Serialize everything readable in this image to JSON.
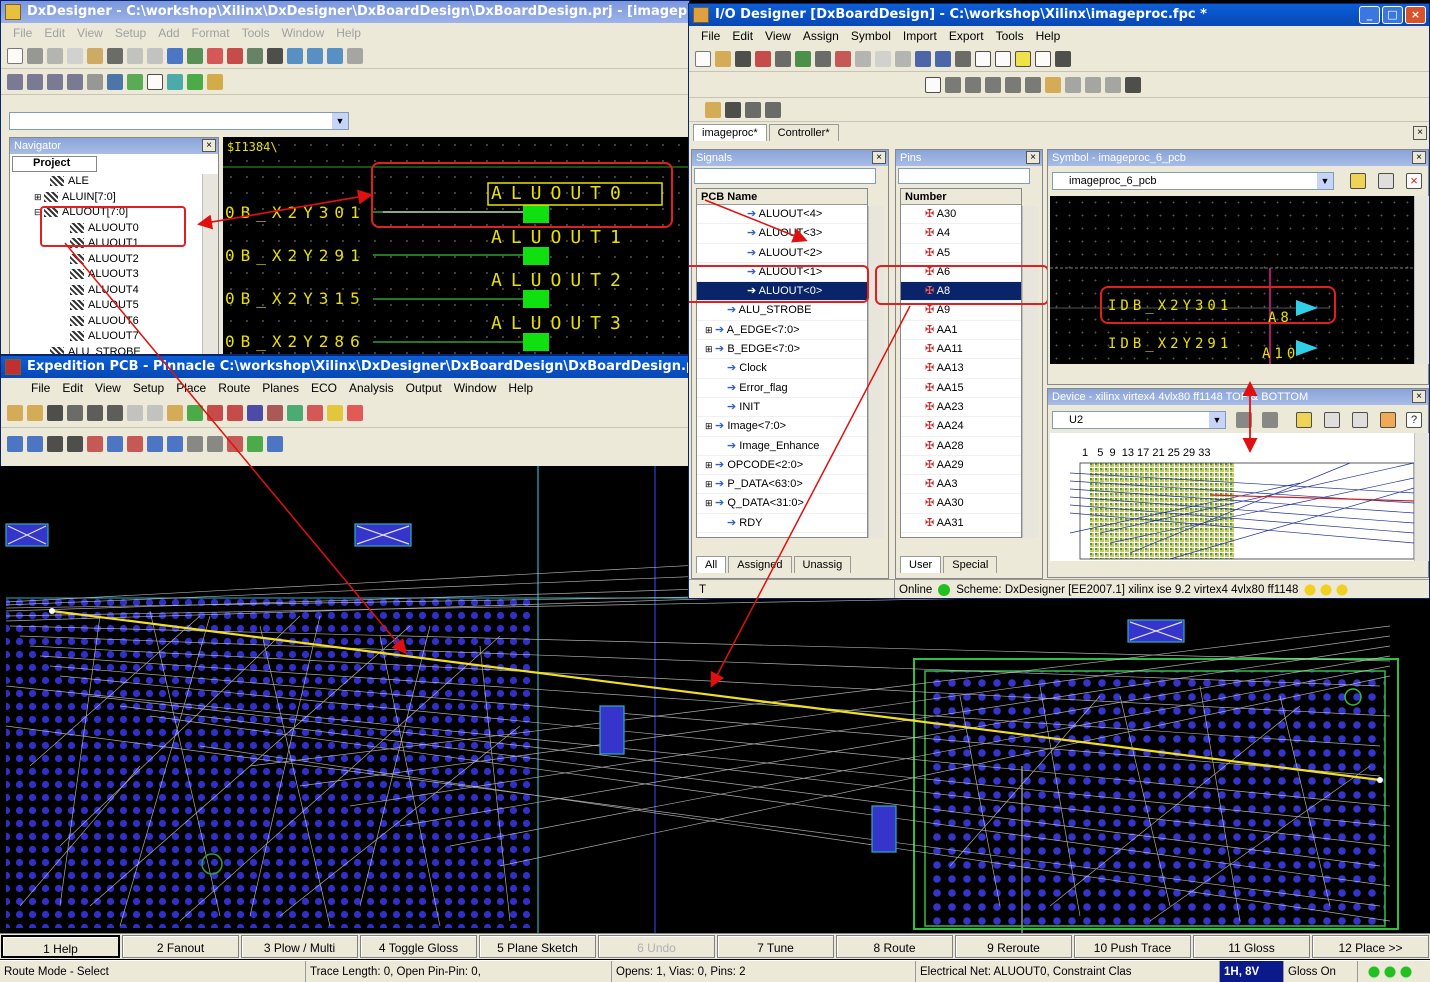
{
  "dx": {
    "title": "DxDesigner - C:\\workshop\\Xilinx\\DxDesigner\\DxBoardDesign\\DxBoardDesign.prj - [imageproc.1]",
    "menu": [
      "File",
      "Edit",
      "View",
      "Setup",
      "Add",
      "Format",
      "Tools",
      "Window",
      "Help"
    ],
    "navigator": "Navigator",
    "project_tab": "Project",
    "tree": [
      "ALE",
      "ALUIN[7:0]",
      "ALUOUT[7:0]",
      "ALUOUT0",
      "ALUOUT1",
      "ALUOUT2",
      "ALUOUT3",
      "ALUOUT4",
      "ALUOUT5",
      "ALUOUT6",
      "ALUOUT7",
      "ALU_STROBE"
    ],
    "sheet_label": "$I1384\\",
    "nets": [
      "0B_X2Y301",
      "0B_X2Y291",
      "0B_X2Y315",
      "0B_X2Y286"
    ],
    "ports": [
      "ALUOUT0",
      "ALUOUT1",
      "ALUOUT2",
      "ALUOUT3"
    ]
  },
  "io": {
    "title": "I/O Designer [DxBoardDesign] - C:\\workshop\\Xilinx\\imageproc.fpc *",
    "menu": [
      "File",
      "Edit",
      "View",
      "Assign",
      "Symbol",
      "Import",
      "Export",
      "Tools",
      "Help"
    ],
    "tabs": [
      "imageproc*",
      "Controller*"
    ],
    "signals_h": "Signals",
    "pins_h": "Pins",
    "symbol_h": "Symbol - imageproc_6_pcb",
    "pcb_name_col": "PCB Name",
    "number_col": "Number",
    "signals": [
      "ALUOUT<4>",
      "ALUOUT<3>",
      "ALUOUT<2>",
      "ALUOUT<1>",
      "ALUOUT<0>",
      "ALU_STROBE",
      "A_EDGE<7:0>",
      "B_EDGE<7:0>",
      "Clock",
      "Error_flag",
      "INIT",
      "Image<7:0>",
      "Image_Enhance",
      "OPCODE<2:0>",
      "P_DATA<63:0>",
      "Q_DATA<31:0>",
      "RDY"
    ],
    "pins": [
      "A30",
      "A4",
      "A5",
      "A6",
      "A8",
      "A9",
      "AA1",
      "AA11",
      "AA13",
      "AA15",
      "AA23",
      "AA24",
      "AA28",
      "AA29",
      "AA3",
      "AA30",
      "AA31"
    ],
    "sig_tabs": [
      "All",
      "Assigned",
      "Unassig"
    ],
    "pin_tabs": [
      "User",
      "Special"
    ],
    "symbol_select": "imageproc_6_pcb",
    "sym_nets": [
      "IDB_X2Y301",
      "IDB_X2Y291"
    ],
    "sym_pins": [
      "A8",
      "A10"
    ],
    "device_h": "Device - xilinx  virtex4  4vlx80  ff1148  TOP & BOTTOM",
    "device_select": "U2",
    "device_cols": "1   5  9  13 17 21 25 29 33",
    "status_left": "T",
    "status_online": "Online",
    "status_scheme": "Scheme: DxDesigner [EE2007.1]  xilinx  ise 9.2  virtex4  4vlx80  ff1148"
  },
  "pcb": {
    "title": "Expedition PCB - Pinnacle  C:\\workshop\\Xilinx\\DxDesigner\\DxBoardDesign\\DxBoardDesign.pcb",
    "menu": [
      "File",
      "Edit",
      "View",
      "Setup",
      "Place",
      "Route",
      "Planes",
      "ECO",
      "Analysis",
      "Output",
      "Window",
      "Help"
    ],
    "fkeys": [
      "1 Help",
      "2 Fanout",
      "3 Plow / Multi",
      "4 Toggle Gloss",
      "5 Plane Sketch",
      "6 Undo",
      "7 Tune",
      "8 Route",
      "9 Reroute",
      "10 Push Trace",
      "11 Gloss",
      "12 Place >>"
    ],
    "status": [
      "Route Mode - Select",
      "Trace Length:  0, Open Pin-Pin:  0,",
      "Opens: 1, Vias: 0, Pins: 2",
      "Electrical Net: ALUOUT0, Constraint Clas",
      "1H, 8V",
      "Gloss On"
    ]
  }
}
